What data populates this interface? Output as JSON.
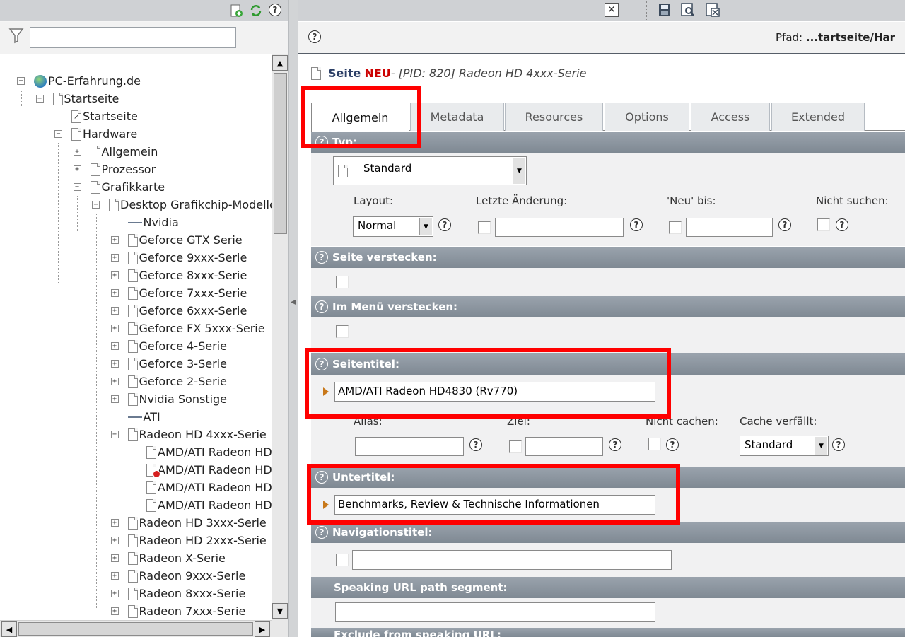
{
  "filter": {
    "placeholder": ""
  },
  "tree": [
    {
      "label": "PC-Erfahrung.de",
      "icon": "globe-icon",
      "level": 0,
      "expander": "-"
    },
    {
      "label": "Startseite",
      "icon": "page-icon",
      "level": 1,
      "expander": "-"
    },
    {
      "label": "Startseite",
      "icon": "shortcut-page-icon",
      "level": 2,
      "expander": ""
    },
    {
      "label": "Hardware",
      "icon": "page-icon",
      "level": 2,
      "expander": "-"
    },
    {
      "label": "Allgemein",
      "icon": "page-icon",
      "level": 3,
      "expander": "+"
    },
    {
      "label": "Prozessor",
      "icon": "page-icon",
      "level": 3,
      "expander": "+"
    },
    {
      "label": "Grafikkarte",
      "icon": "page-icon",
      "level": 3,
      "expander": "-"
    },
    {
      "label": "Desktop Grafikchip-Modelle",
      "icon": "page-icon",
      "level": 4,
      "expander": "-"
    },
    {
      "label": "Nvidia",
      "icon": "separator-icon",
      "level": 5,
      "expander": ""
    },
    {
      "label": "Geforce GTX Serie",
      "icon": "page-icon",
      "level": 5,
      "expander": "+"
    },
    {
      "label": "Geforce 9xxx-Serie",
      "icon": "page-icon",
      "level": 5,
      "expander": "+"
    },
    {
      "label": "Geforce 8xxx-Serie",
      "icon": "page-icon",
      "level": 5,
      "expander": "+"
    },
    {
      "label": "Geforce 7xxx-Serie",
      "icon": "page-icon",
      "level": 5,
      "expander": "+"
    },
    {
      "label": "Geforce 6xxx-Serie",
      "icon": "page-icon",
      "level": 5,
      "expander": "+"
    },
    {
      "label": "Geforce FX 5xxx-Serie",
      "icon": "page-icon",
      "level": 5,
      "expander": "+"
    },
    {
      "label": "Geforce 4-Serie",
      "icon": "page-icon",
      "level": 5,
      "expander": "+"
    },
    {
      "label": "Geforce 3-Serie",
      "icon": "page-icon",
      "level": 5,
      "expander": "+"
    },
    {
      "label": "Geforce 2-Serie",
      "icon": "page-icon",
      "level": 5,
      "expander": "+"
    },
    {
      "label": "Nvidia Sonstige",
      "icon": "page-icon",
      "level": 5,
      "expander": "+"
    },
    {
      "label": "ATI",
      "icon": "separator-icon",
      "level": 5,
      "expander": ""
    },
    {
      "label": "Radeon HD 4xxx-Serie",
      "icon": "page-icon",
      "level": 5,
      "expander": "-"
    },
    {
      "label": "AMD/ATI Radeon HD",
      "icon": "page-icon",
      "level": 6,
      "expander": ""
    },
    {
      "label": "AMD/ATI Radeon HD",
      "icon": "page-hidden-icon",
      "level": 6,
      "expander": ""
    },
    {
      "label": "AMD/ATI Radeon HD",
      "icon": "page-icon",
      "level": 6,
      "expander": ""
    },
    {
      "label": "AMD/ATI Radeon HD",
      "icon": "page-icon",
      "level": 6,
      "expander": ""
    },
    {
      "label": "Radeon HD 3xxx-Serie",
      "icon": "page-icon",
      "level": 5,
      "expander": "+"
    },
    {
      "label": "Radeon HD 2xxx-Serie",
      "icon": "page-icon",
      "level": 5,
      "expander": "+"
    },
    {
      "label": "Radeon X-Serie",
      "icon": "page-icon",
      "level": 5,
      "expander": "+"
    },
    {
      "label": "Radeon 9xxx-Serie",
      "icon": "page-icon",
      "level": 5,
      "expander": "+"
    },
    {
      "label": "Radeon 8xxx-Serie",
      "icon": "page-icon",
      "level": 5,
      "expander": "+"
    },
    {
      "label": "Radeon 7xxx-Serie",
      "icon": "page-icon",
      "level": 5,
      "expander": "+"
    }
  ],
  "header": {
    "path_label": "Pfad:",
    "path_value": "...tartseite/Har",
    "page_word": "Seite",
    "new_word": "NEU",
    "subtitle": " - [PID: 820] Radeon HD 4xxx-Serie"
  },
  "tabs": [
    "Allgemein",
    "Metadata",
    "Resources",
    "Options",
    "Access",
    "Extended"
  ],
  "typ": {
    "label": "Typ:",
    "value": "Standard"
  },
  "layout_row": {
    "layout_label": "Layout:",
    "layout_value": "Normal",
    "lastchange_label": "Letzte Änderung:",
    "neu_label": "'Neu' bis:",
    "nosearch_label": "Nicht suchen:"
  },
  "sections": {
    "hide_page": "Seite verstecken:",
    "hide_menu": "Im Menü verstecken:",
    "title": "Seitentitel:",
    "subtitle": "Untertitel:",
    "nav_title": "Navigationstitel:",
    "speaking_url": "Speaking URL path segment:",
    "exclude_url": "Exclude from speaking URL:"
  },
  "fields": {
    "title_value": "AMD/ATI Radeon HD4830 (Rv770)",
    "subtitle_value": "Benchmarks, Review & Technische Informationen",
    "alias_label": "Alias:",
    "ziel_label": "Ziel:",
    "nocache_label": "Nicht cachen:",
    "cache_label": "Cache verfällt:",
    "cache_value": "Standard"
  },
  "colors": {
    "highlight": "#ff0000",
    "new_badge": "#cc0000",
    "section_bar": "#8a939d"
  }
}
